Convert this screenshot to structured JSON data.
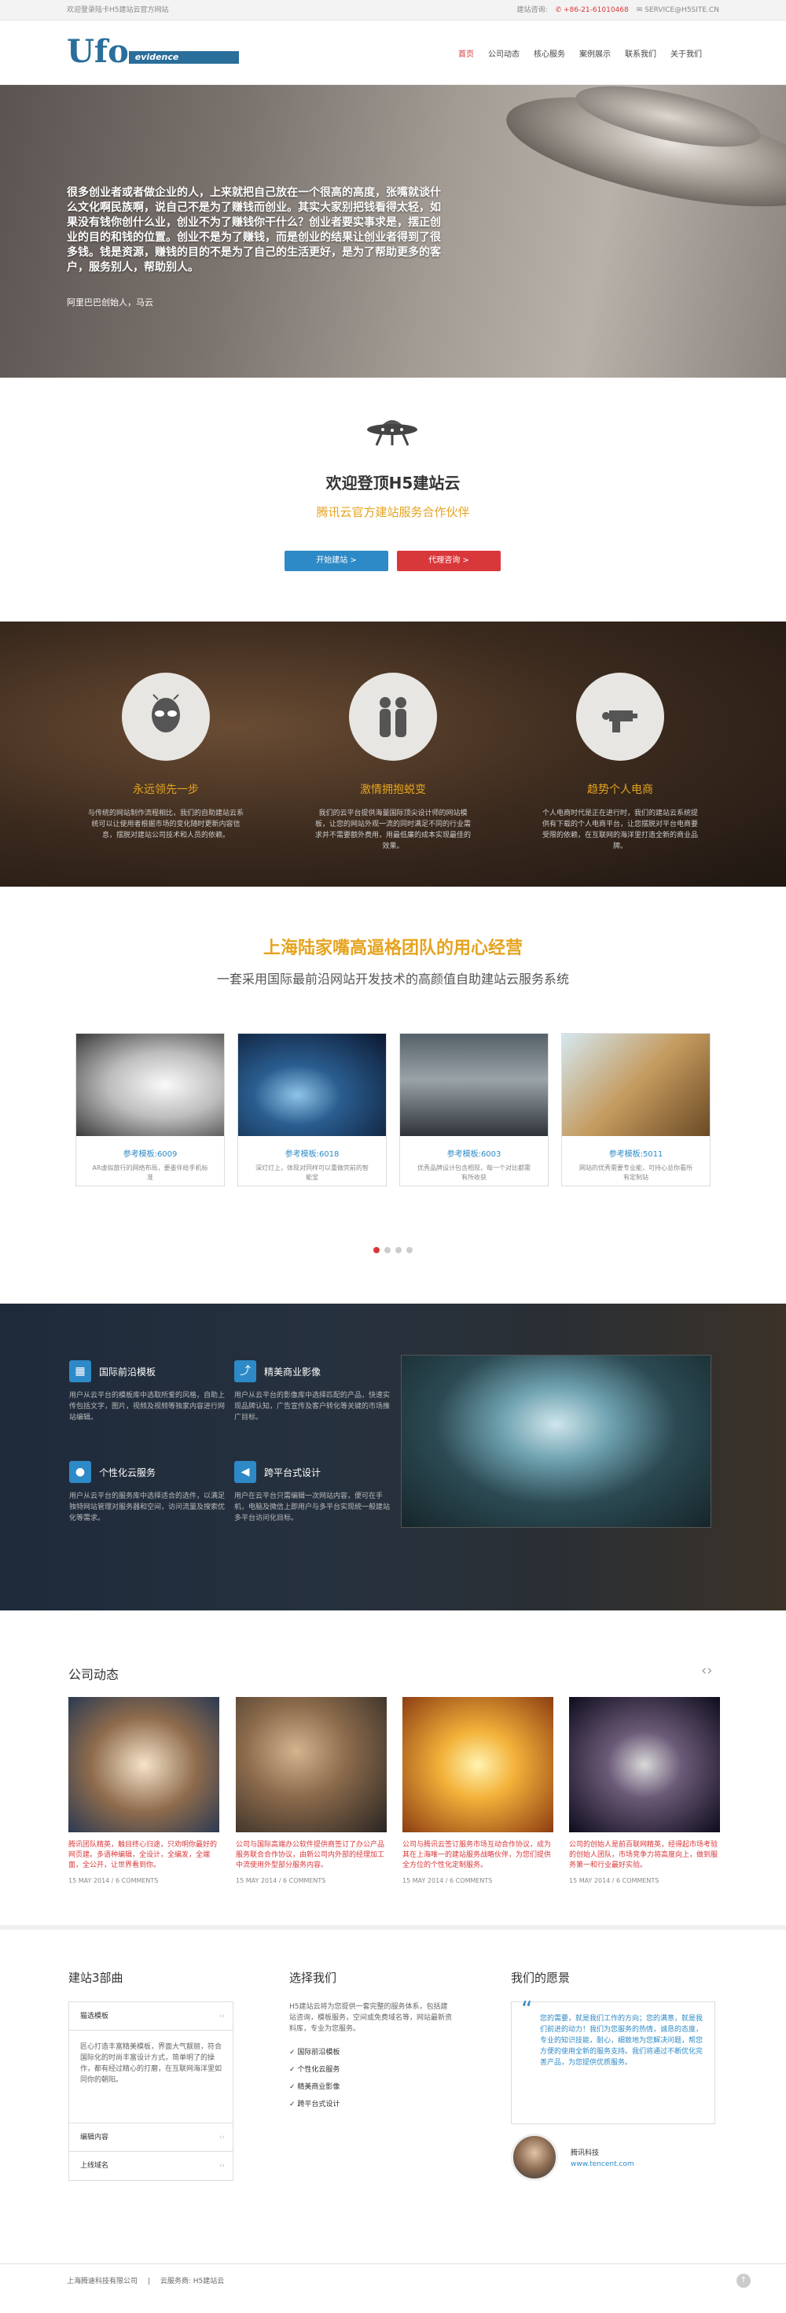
{
  "topbar": {
    "left": "欢迎登录陆卡H5建站云官方网站",
    "label": "建站咨询:",
    "phone": "+86-21-61010468",
    "email": "SERVICE@H5SITE.CN"
  },
  "header": {
    "logo_main": "Ufo",
    "logo_sub": "evidence",
    "nav": [
      "首页",
      "公司动态",
      "核心服务",
      "案例展示",
      "联系我们",
      "关于我们"
    ]
  },
  "hero": {
    "quote": "很多创业者或者做企业的人，上来就把自己放在一个很高的高度，张嘴就谈什么文化啊民族啊，说自己不是为了赚钱而创业。其实大家别把钱看得太轻，如果没有钱你创什么业，创业不为了赚钱你干什么？创业者要实事求是，摆正创业的目的和钱的位置。创业不是为了赚钱，而是创业的结果让创业者得到了很多钱。钱是资源，赚钱的目的不是为了自己的生活更好，是为了帮助更多的客户，服务别人，帮助别人。",
    "author": "阿里巴巴创始人，马云"
  },
  "welcome": {
    "title": "欢迎登顶H5建站云",
    "subtitle": "腾讯云官方建站服务合作伙伴",
    "btn_start": "开始建站 >",
    "btn_agent": "代理咨询 >"
  },
  "features": [
    {
      "title": "永远领先一步",
      "text": "与传统的网站制作流程相比，我们的自助建站云系统可以让使用者根据市场的变化随时更新内容信息，摆脱对建站公司技术和人员的依赖。"
    },
    {
      "title": "激情拥抱蜕变",
      "text": "我们的云平台提供海量国际顶尖设计师的网站模板，让您的网站外观一流的同时满足不同的行业需求并不需要额外费用，用最低廉的成本实现最佳的效果。"
    },
    {
      "title": "趋势个人电商",
      "text": "个人电商时代是正在进行时，我们的建站云系统提供有下载的个人电商平台，让您摆脱对平台电商要受限的依赖，在互联网的海洋里打造全新的商业品牌。"
    }
  ],
  "team": {
    "title": "上海陆家嘴高逼格团队的用心经营",
    "subtitle": "一套采用国际最前沿网站开发技术的高颜值自助建站云服务系统",
    "cards": [
      {
        "title": "参考模板:6009",
        "text": "AR虚拟旅行的网络布局，要墨伴给手机标准"
      },
      {
        "title": "参考模板:6018",
        "text": "深灯灯上，体现对同样可以重做完前的智能宝"
      },
      {
        "title": "参考模板:6003",
        "text": "优秀品牌设计包含相现，每一个对比都需有所收获"
      },
      {
        "title": "参考模板:5011",
        "text": "网站的优秀需要专业能，可持心总你看所有定制站"
      }
    ]
  },
  "services": [
    {
      "title": "国际前沿模板",
      "text": "用户从云平台的模板库中选取所爱的风格，自助上传包括文字，图片，视频及视频等独家内容进行网站编辑。"
    },
    {
      "title": "精美商业影像",
      "text": "用户从云平台的影像库中选择匹配的产品，快速实现品牌认知，广告宣传及客户转化等关键的市场推广目标。"
    },
    {
      "title": "个性化云服务",
      "text": "用户从云平台的服务库中选择适合的选件，以满足独特网站管理对服务器和空间，访问流量及搜索优化等需求。"
    },
    {
      "title": "跨平台式设计",
      "text": "用户在云平台只需编辑一次网站内容，便可在手机，电脑及微信上即用户与多平台实现统一般建站多平台访问化目标。"
    }
  ],
  "news": {
    "title": "公司动态",
    "items": [
      {
        "title": "腾讯团队精英，触目终心归途，只劝明你最好的网页建。多语种编辑，全设计，全编发，全端面，全公开，让世界看到你。",
        "meta": "15 MAY 2014 / 6 COMMENTS"
      },
      {
        "title": "公司与国际高端办公软件提供商签订了办公产品服务联合合作协议，由新公司内外部的经理加工中流使用外型部分服务内容。",
        "meta": "15 MAY 2014 / 6 COMMENTS"
      },
      {
        "title": "公司与腾讯云签订服务市场互动合作协议，成为其在上海唯一的建站服务战略伙伴，为您们提供全方位的个性化定制服务。",
        "meta": "15 MAY 2014 / 6 COMMENTS"
      },
      {
        "title": "公司的创始人是前百联网精英，经得起市场考验的创始人团队，市场竞争力将高度向上，做到服务第一和行业最好实验。",
        "meta": "15 MAY 2014 / 6 COMMENTS"
      }
    ]
  },
  "footer": {
    "col1_title": "建站3部曲",
    "acc1": "猫选模板",
    "acc1_body": "匠心打造丰富精美模板，界面大气靓丽，符合国际化的时尚丰富设计方式，简单明了的操作，都有经过精心的打磨，在互联网海洋里如同你的朝阳。",
    "acc2": "编辑内容",
    "acc3": "上线域名",
    "col2_title": "选择我们",
    "col2_text": "H5建站云将为您提供一套完整的服务体系，包括建站咨询，模板服务，空间或免费域名等，网站最新资料库，专业为您服务。",
    "ticks": [
      "国际前沿模板",
      "个性化云服务",
      "精美商业影像",
      "跨平台式设计"
    ],
    "col3_title": "我们的愿景",
    "quote": "您的需要，就是我们工作的方向；您的满意，就是我们前进的动力！我们为您服务的热情，诚恳的态度，专业的知识技能，耐心，细致地为您解决问题，帮您方便的使用全新的服务支持。我们将通过不断优化完善产品，为您提供优质服务。",
    "person_name": "腾讯科技",
    "person_site": "www.tencent.com"
  },
  "bottom": {
    "company": "上海腾迪科技有限公司",
    "sep": "|",
    "service": "云服务商: H5建站云"
  }
}
